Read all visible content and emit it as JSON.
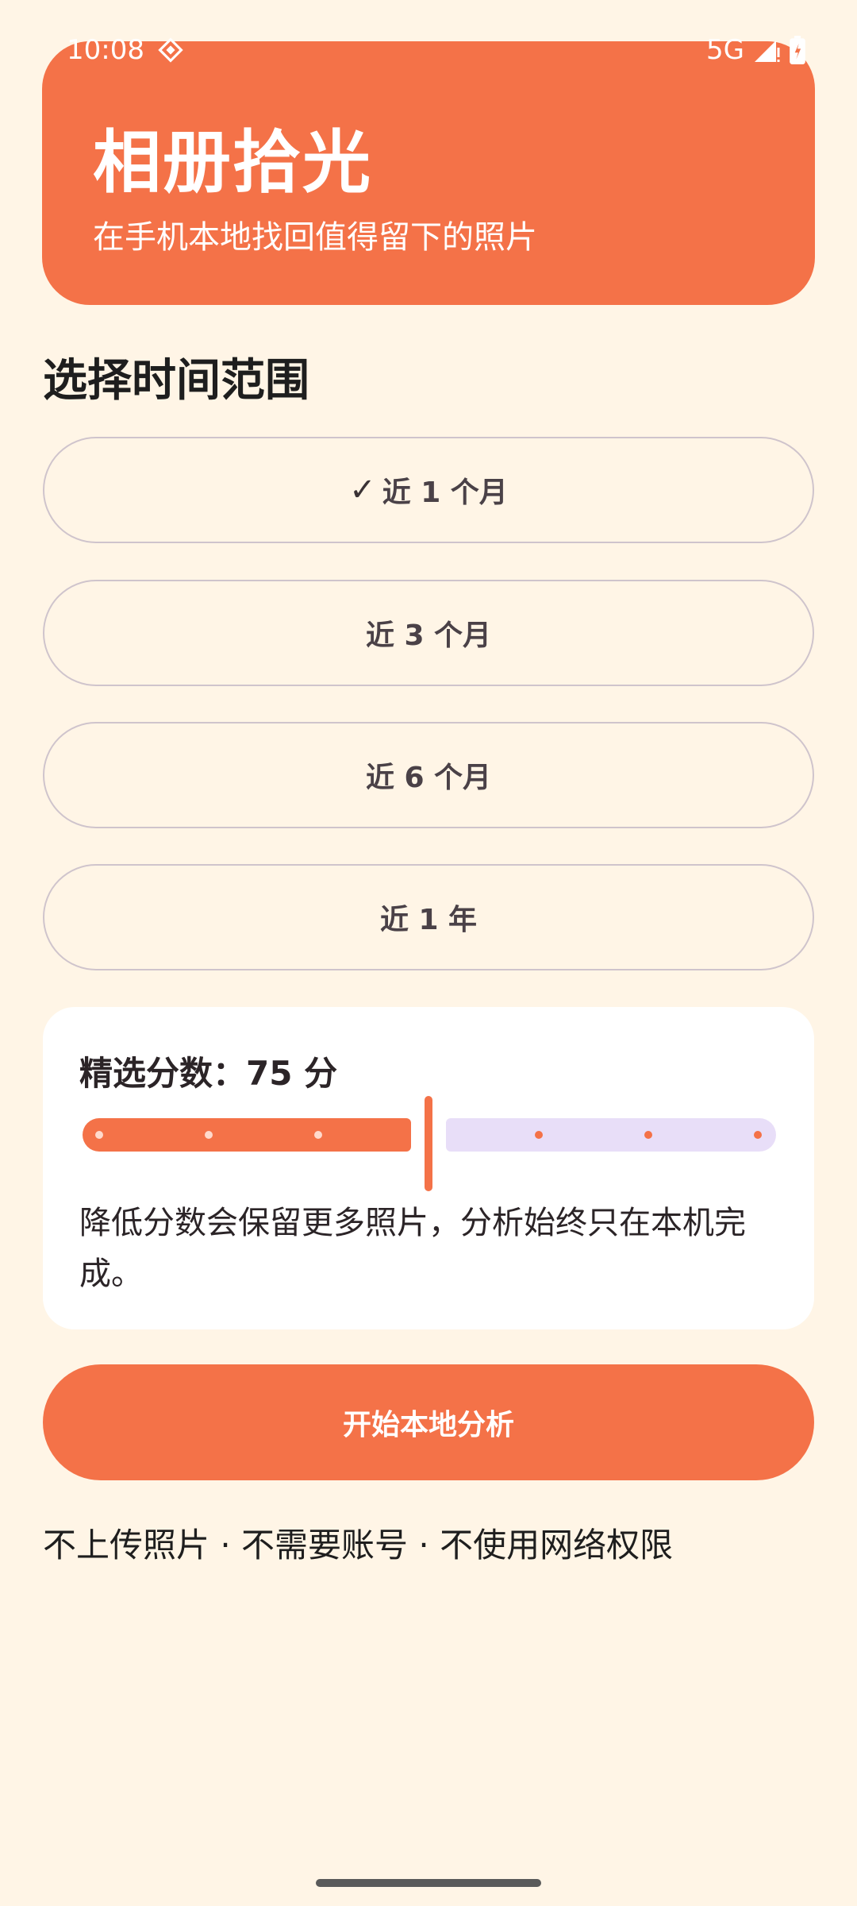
{
  "status_bar": {
    "time": "10:08",
    "network": "5G",
    "icons": [
      "data-saver-icon",
      "signal-icon",
      "battery-icon"
    ]
  },
  "header": {
    "title": "相册拾光",
    "subtitle": "在手机本地找回值得留下的照片"
  },
  "range_section": {
    "title": "选择时间范围",
    "selected_index": 0,
    "options": [
      {
        "check": "✓",
        "label": "近 1 个月"
      },
      {
        "label": "近 3 个月"
      },
      {
        "label": "近 6 个月"
      },
      {
        "label": "近 1 年"
      }
    ]
  },
  "score_card": {
    "label": "精选分数：75 分",
    "slider": {
      "value": 75,
      "min": 0,
      "max": 100
    },
    "description": "降低分数会保留更多照片，分析始终只在本机完成。"
  },
  "start_button": {
    "label": "开始本地分析"
  },
  "footer_note": "不上传照片 · 不需要账号 · 不使用网络权限",
  "colors": {
    "background": "#FFF5E6",
    "accent": "#F47248",
    "slider_inactive": "#E8DEF8",
    "outline": "#CFC4CC"
  }
}
